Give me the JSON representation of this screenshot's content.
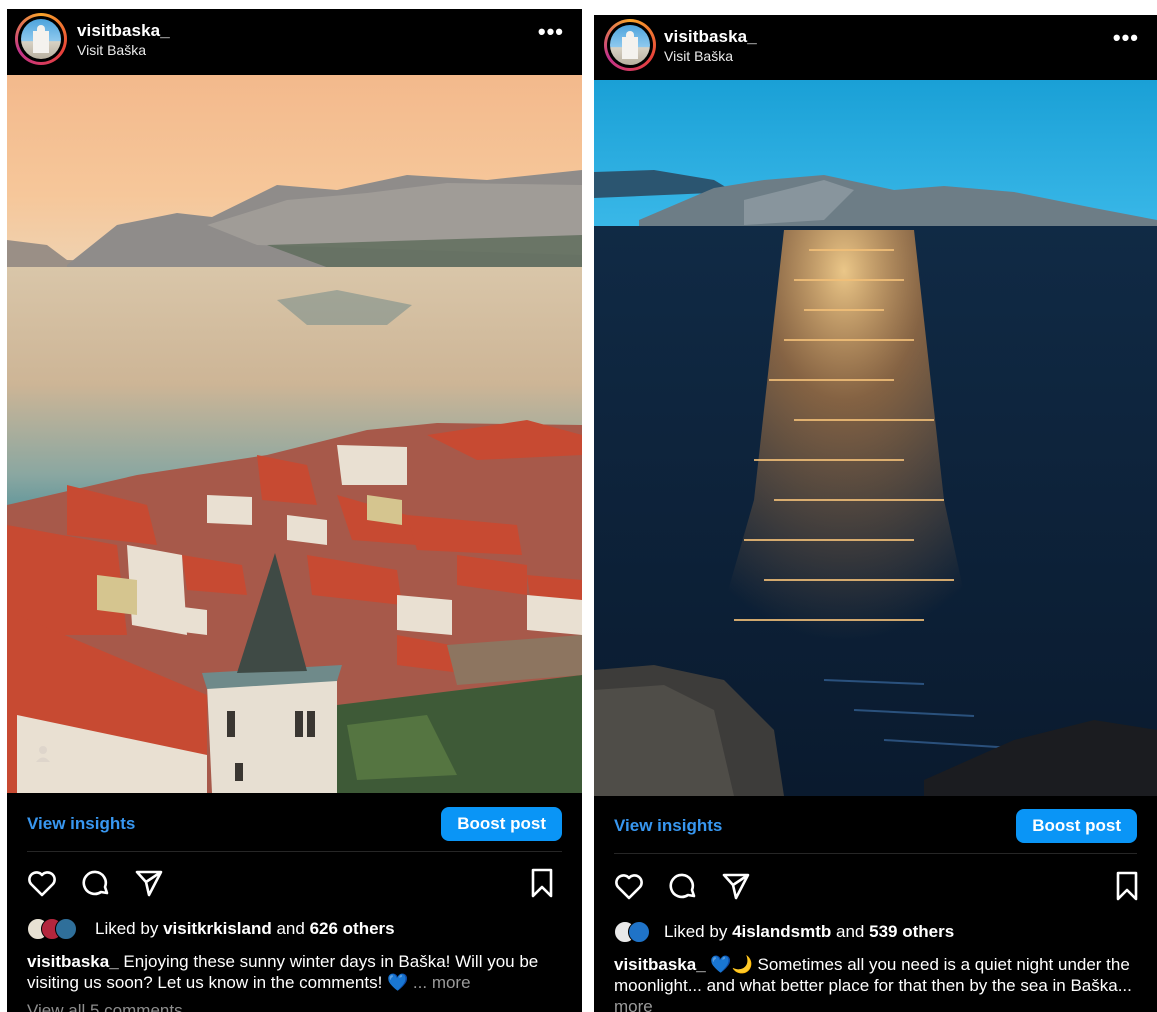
{
  "posts": [
    {
      "username": "visitbaska_",
      "location": "Visit Baška",
      "more_label": "•••",
      "insights_label": "View insights",
      "boost_label": "Boost post",
      "liked_prefix": "Liked by",
      "liked_user": "visitkrkisland",
      "liked_and": "and",
      "liked_count": "626 others",
      "caption_user": "visitbaska_",
      "caption_text": "Enjoying these sunny winter days in Baška! Will you be visiting us soon? Let us know in the comments! 💙",
      "caption_more": "... more",
      "comments_label": "View all 5 comments",
      "photo_desc_icon": "person-tag-icon"
    },
    {
      "username": "visitbaska_",
      "location": "Visit Baška",
      "more_label": "•••",
      "insights_label": "View insights",
      "boost_label": "Boost post",
      "liked_prefix": "Liked by",
      "liked_user": "4islandsmtb",
      "liked_and": "and",
      "liked_count": "539 others",
      "caption_user": "visitbaska_",
      "caption_text": "💙🌙 Sometimes all you need is a quiet night under the moonlight... and what better place for that then by the sea in Baška...",
      "caption_more": "more"
    }
  ],
  "colors": {
    "background": "#000000",
    "link_blue": "#3897f0",
    "boost_blue": "#0a95f6",
    "muted": "#8e8e8e"
  },
  "icons": [
    "heart-icon",
    "comment-icon",
    "share-icon",
    "bookmark-icon",
    "more-icon"
  ]
}
